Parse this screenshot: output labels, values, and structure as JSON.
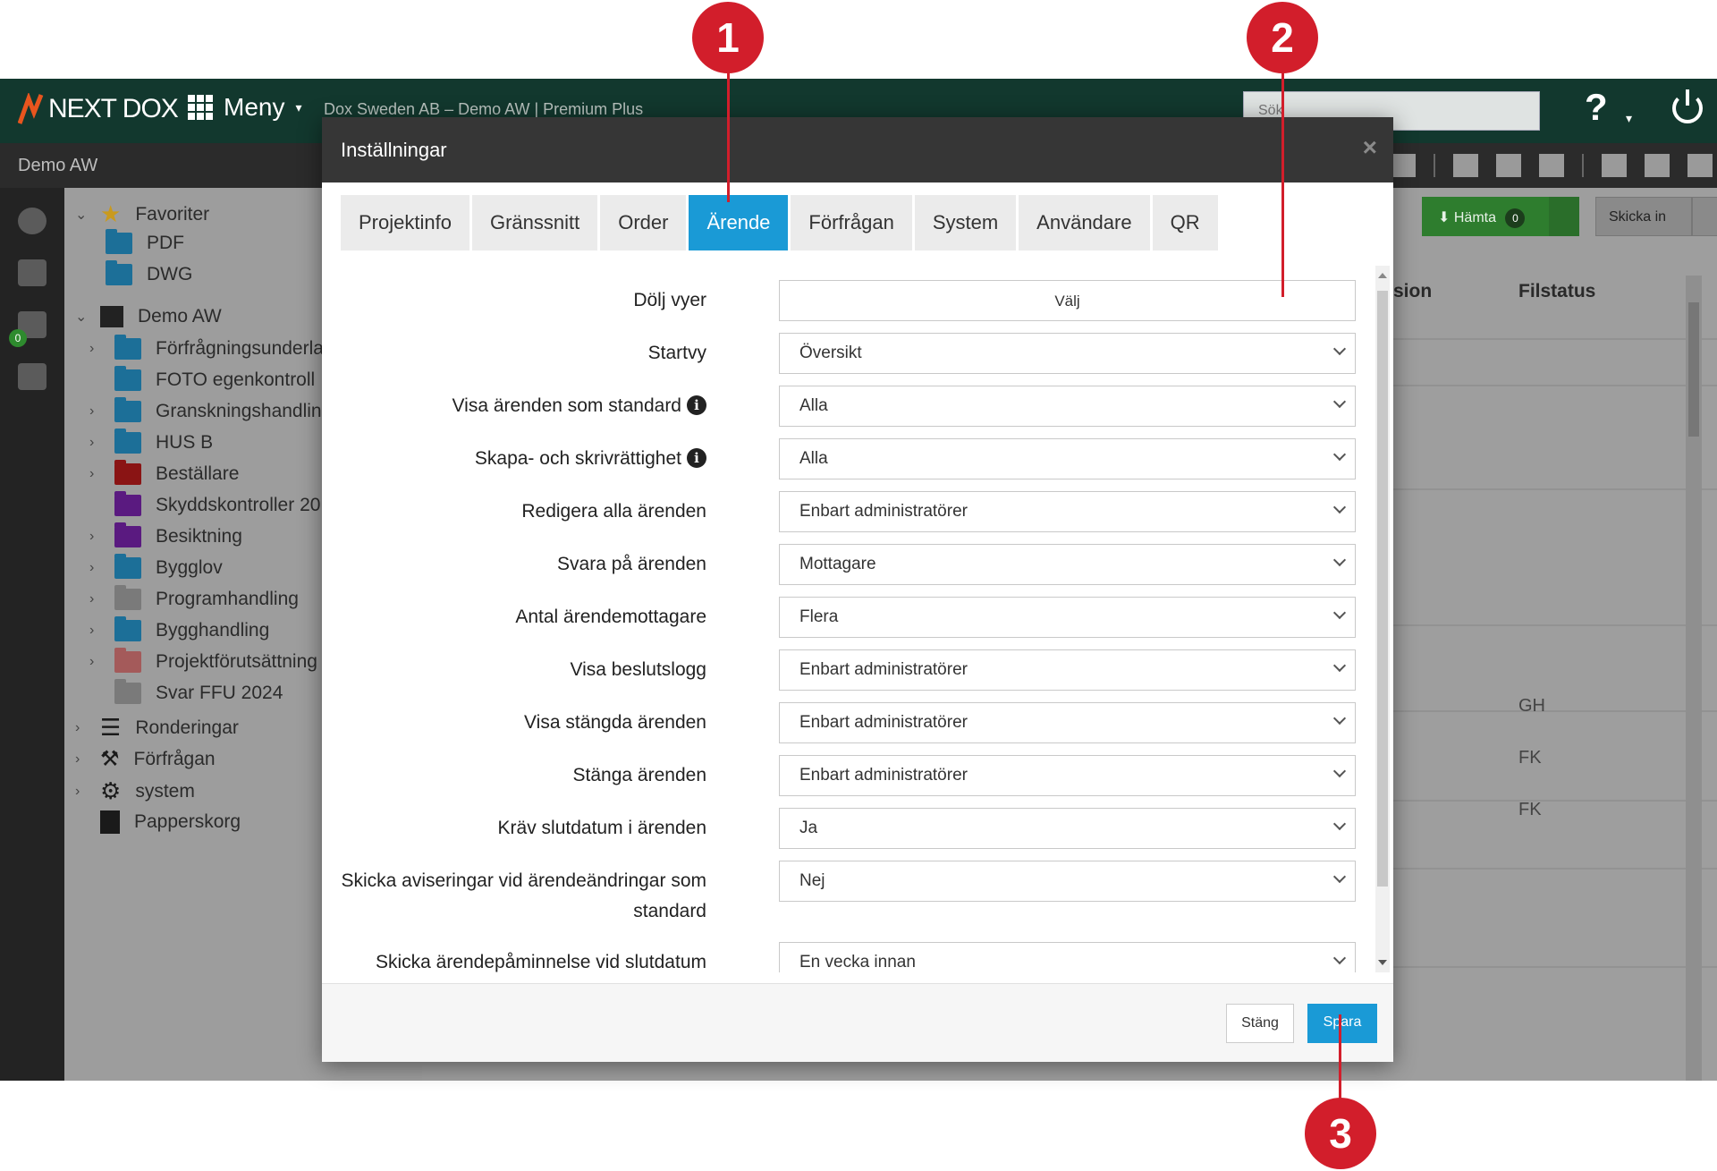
{
  "colors": {
    "accent": "#1a9ad6",
    "topbar": "#12382e",
    "callout": "#d21e2b",
    "download": "#2e7d2e"
  },
  "topbar": {
    "logo": "NEXT DOX",
    "menu_label": "Meny",
    "company": "Dox Sweden AB – Demo AW | Premium Plus",
    "search_placeholder": "Sök",
    "help_label": "?"
  },
  "subbar": {
    "project": "Demo AW"
  },
  "rail": {
    "badge": "0"
  },
  "tree": {
    "items": [
      {
        "label": "Favoriter",
        "icon": "star-icon"
      },
      {
        "label": "PDF",
        "icon": "folder-icon"
      },
      {
        "label": "DWG",
        "icon": "folder-icon"
      },
      {
        "label": "Demo AW",
        "icon": "archive-box-icon"
      },
      {
        "label": "Förfrågningsunderla",
        "icon": "folder-icon"
      },
      {
        "label": "FOTO egenkontroll",
        "icon": "folder-icon"
      },
      {
        "label": "Granskningshandlin",
        "icon": "folder-icon"
      },
      {
        "label": "HUS B",
        "icon": "folder-icon"
      },
      {
        "label": "Beställare",
        "icon": "folder-icon"
      },
      {
        "label": "Skyddskontroller 20",
        "icon": "folder-icon"
      },
      {
        "label": "Besiktning",
        "icon": "folder-icon"
      },
      {
        "label": "Bygglov",
        "icon": "folder-icon"
      },
      {
        "label": "Programhandling",
        "icon": "folder-icon"
      },
      {
        "label": "Bygghandling",
        "icon": "folder-icon"
      },
      {
        "label": "Projektförutsättning",
        "icon": "folder-icon"
      },
      {
        "label": "Svar FFU 2024",
        "icon": "folder-icon"
      },
      {
        "label": "Ronderingar",
        "icon": "list-icon"
      },
      {
        "label": "Förfrågan",
        "icon": "gavel-icon"
      },
      {
        "label": "system",
        "icon": "gear-icon"
      },
      {
        "label": "Papperskorg",
        "icon": "trash-icon"
      }
    ]
  },
  "content": {
    "download_label": "Hämta",
    "download_count": "0",
    "submit_label": "Skicka in",
    "col_version": "sion",
    "col_filestatus": "Filstatus",
    "filestatus_values": [
      "GH",
      "FK",
      "FK"
    ]
  },
  "modal": {
    "title": "Inställningar",
    "close": "×",
    "tabs": [
      "Projektinfo",
      "Gränssnitt",
      "Order",
      "Ärende",
      "Förfrågan",
      "System",
      "Användare",
      "QR"
    ],
    "active_tab": "Ärende",
    "fields": [
      {
        "label": "Dölj vyer",
        "type": "button",
        "value": "Välj"
      },
      {
        "label": "Startvy",
        "value": "Översikt"
      },
      {
        "label": "Visa ärenden som standard",
        "value": "Alla",
        "info": true
      },
      {
        "label": "Skapa- och skrivrättighet",
        "value": "Alla",
        "info": true
      },
      {
        "label": "Redigera alla ärenden",
        "value": "Enbart administratörer"
      },
      {
        "label": "Svara på ärenden",
        "value": "Mottagare"
      },
      {
        "label": "Antal ärendemottagare",
        "value": "Flera"
      },
      {
        "label": "Visa beslutslogg",
        "value": "Enbart administratörer"
      },
      {
        "label": "Visa stängda ärenden",
        "value": "Enbart administratörer"
      },
      {
        "label": "Stänga ärenden",
        "value": "Enbart administratörer"
      },
      {
        "label": "Kräv slutdatum i ärenden",
        "value": "Ja"
      },
      {
        "label_line1": "Skicka aviseringar vid ärendeändringar som",
        "label_line2": "standard",
        "value": "Nej"
      },
      {
        "label": "Skicka ärendepåminnelse vid slutdatum",
        "value": "En vecka innan"
      }
    ],
    "close_button": "Stäng",
    "save_button": "Spara"
  },
  "callouts": [
    "1",
    "2",
    "3"
  ]
}
